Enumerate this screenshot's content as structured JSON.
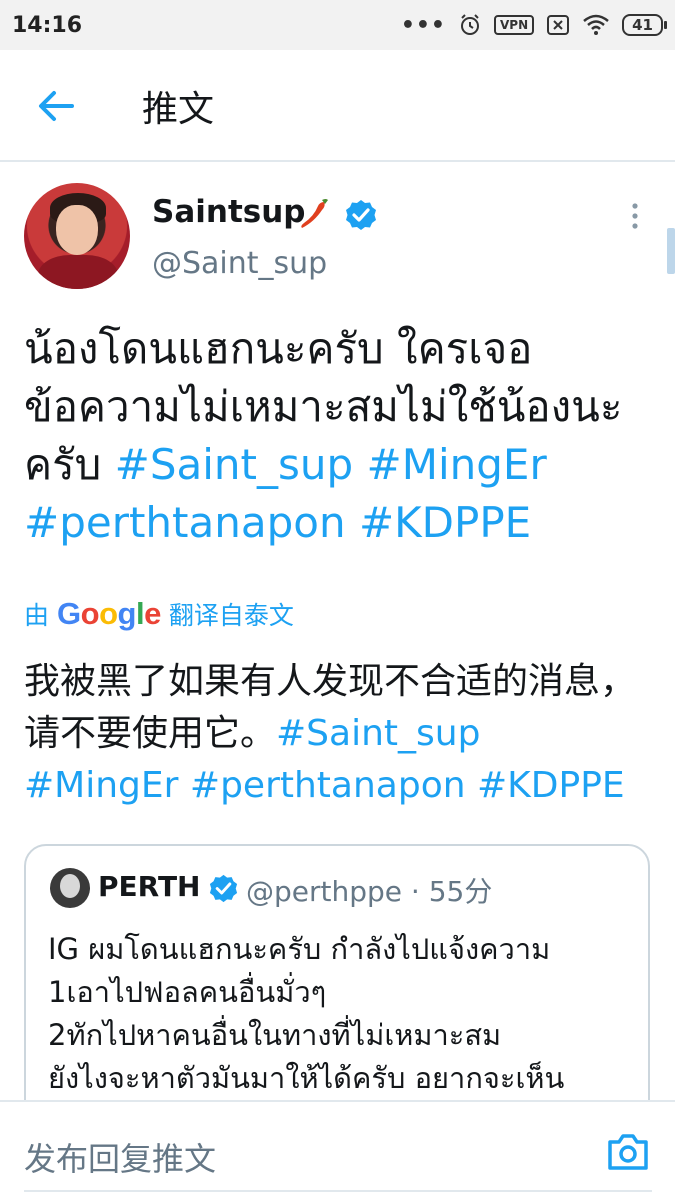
{
  "status_bar": {
    "time": "14:16",
    "dots": "•••",
    "vpn_label": "VPN",
    "battery": "41"
  },
  "header": {
    "title": "推文"
  },
  "tweet": {
    "author_name": "Saintsup",
    "handle": "@Saint_sup",
    "text_plain": "น้องโดนแฮกนะครับ ใครเจอข้อความไม่เหมาะสมไม่ใช้น้องนะครับ ",
    "hashtags": [
      "#Saint_sup",
      "#MingEr",
      "#perthtanapon",
      "#KDPPE"
    ],
    "translated_prefix": "由",
    "translated_suffix": "翻译自泰文",
    "translation_plain": "我被黑了如果有人发现不合适的消息，请不要使用它。",
    "translation_hashtags": [
      "#Saint_sup",
      "#MingEr",
      "#perthtanapon",
      "#KDPPE"
    ]
  },
  "google_logo": [
    "G",
    "o",
    "o",
    "g",
    "l",
    "e"
  ],
  "quoted_tweet": {
    "name": "PERTH",
    "handle_time": "@perthppe · 55分",
    "lines": [
      "IG ผมโดนแฮกนะครับ กำลังไปแจ้งความ",
      "1เอาไปฟอลคนอื่นมั่วๆ",
      "2ทักไปหาคนอื่นในทางที่ไม่เหมาะสม",
      "ยังไงจะหาตัวมันมาให้ได้ครับ อยากจะเห็น"
    ]
  },
  "reply_bar": {
    "placeholder": "发布回复推文"
  },
  "icons": {
    "back": "arrow-left-icon",
    "verified": "verified-badge-icon",
    "chili": "chili-pepper-icon",
    "more": "more-vertical-icon",
    "camera": "camera-icon"
  },
  "colors": {
    "accent": "#1da1f2",
    "text": "#14171a",
    "secondary": "#657786"
  }
}
